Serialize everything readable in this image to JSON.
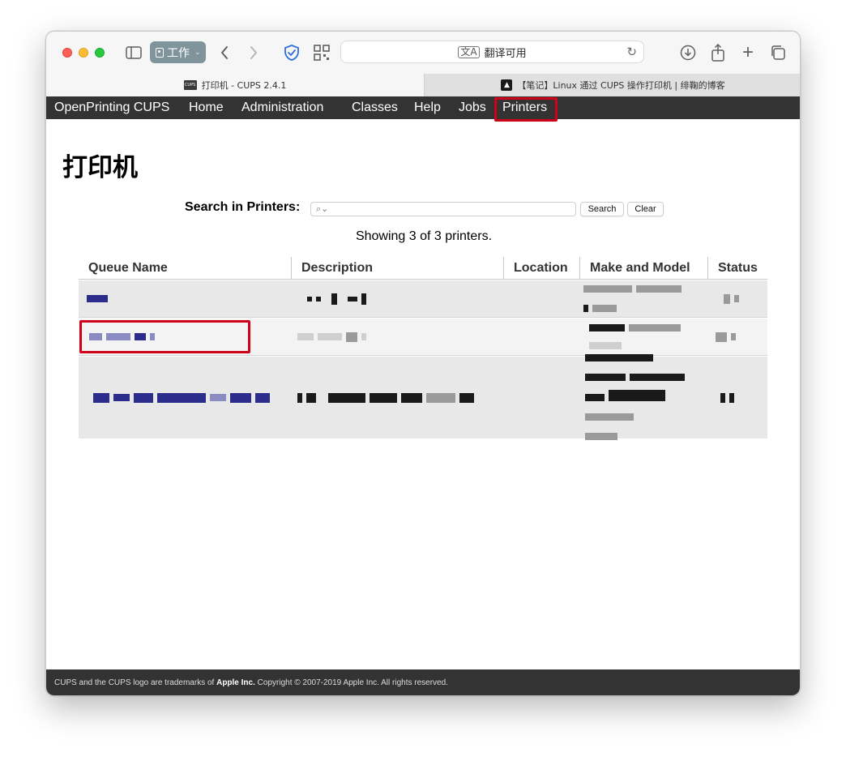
{
  "toolbar": {
    "profile_label": "工作",
    "url_text": "翻译可用"
  },
  "tabs": [
    {
      "label": "打印机 - CUPS 2.4.1",
      "favicon_text": "CUPS"
    },
    {
      "label": "【笔记】Linux 通过 CUPS 操作打印机 | 绯鞠的博客"
    }
  ],
  "nav": {
    "brand": "OpenPrinting CUPS",
    "home": "Home",
    "administration": "Administration",
    "classes": "Classes",
    "help": "Help",
    "jobs": "Jobs",
    "printers": "Printers"
  },
  "page": {
    "title": "打印机",
    "search_label": "Search in Printers:",
    "search_value": "",
    "search_button": "Search",
    "clear_button": "Clear",
    "showing": "Showing 3 of 3 printers."
  },
  "table": {
    "columns": [
      "Queue Name",
      "Description",
      "Location",
      "Make and Model",
      "Status"
    ]
  },
  "footer": {
    "prefix": "CUPS and the CUPS logo are trademarks of ",
    "brand": "Apple Inc.",
    "suffix": " Copyright © 2007-2019 Apple Inc. All rights reserved."
  },
  "colors": {
    "nav_bg": "#333333",
    "highlight": "#d0021b",
    "link": "#2c2c8c"
  }
}
